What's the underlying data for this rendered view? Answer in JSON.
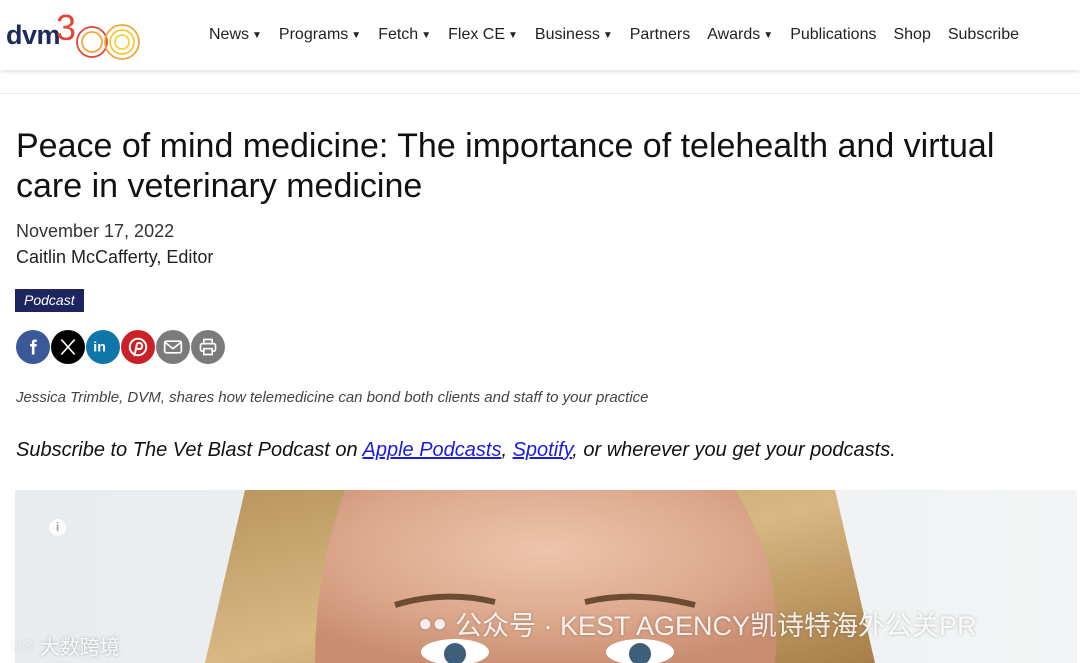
{
  "brand": {
    "logo_text": "dvm",
    "accent_colors": [
      "#e5443a",
      "#f0a73a",
      "#f3d23a"
    ]
  },
  "nav": {
    "items": [
      {
        "label": "News",
        "dropdown": true
      },
      {
        "label": "Programs",
        "dropdown": true
      },
      {
        "label": "Fetch",
        "dropdown": true
      },
      {
        "label": "Flex CE",
        "dropdown": true
      },
      {
        "label": "Business",
        "dropdown": true
      },
      {
        "label": "Partners",
        "dropdown": false
      },
      {
        "label": "Awards",
        "dropdown": true
      },
      {
        "label": "Publications",
        "dropdown": false
      },
      {
        "label": "Shop",
        "dropdown": false
      },
      {
        "label": "Subscribe",
        "dropdown": false
      }
    ]
  },
  "article": {
    "title": "Peace of mind medicine: The importance of telehealth and virtual care in veterinary medicine",
    "date": "November 17, 2022",
    "author": "Caitlin McCafferty, Editor",
    "tag": "Podcast",
    "subtitle": "Jessica Trimble, DVM, shares how telemedicine can bond both clients and staff to your practice",
    "subscribe": {
      "prefix": "Subscribe to The Vet Blast Podcast on ",
      "link1": "Apple Podcasts",
      "sep": ", ",
      "link2": "Spotify",
      "suffix": ", or wherever you get your podcasts."
    }
  },
  "share": {
    "icons": [
      "facebook-icon",
      "x-icon",
      "linkedin-icon",
      "pinterest-icon",
      "email-icon",
      "print-icon"
    ]
  },
  "photo": {
    "info_icon": "i"
  },
  "watermark": {
    "main": "公众号 · KEST AGENCY凯诗特海外公关PR",
    "corner": "大数跨境"
  }
}
